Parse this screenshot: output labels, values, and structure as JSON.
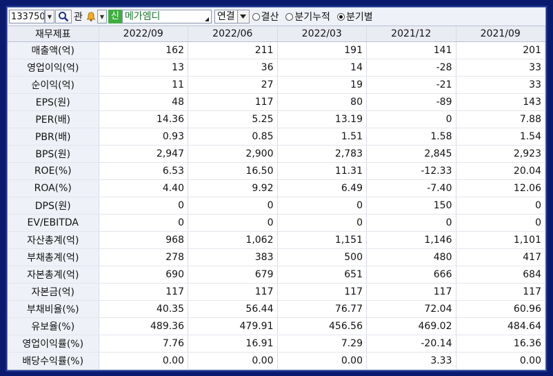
{
  "toolbar": {
    "stock_code": "133750",
    "label_gwan": "관",
    "new_badge": "신",
    "company_name": "메가엠디",
    "report_select": "연결",
    "radios": [
      {
        "label": "결산",
        "checked": false
      },
      {
        "label": "분기누적",
        "checked": false
      },
      {
        "label": "분기별",
        "checked": true
      }
    ],
    "icons": [
      "search-icon",
      "bell-icon",
      "dropdown-arrow-icon"
    ]
  },
  "table": {
    "header_label": "재무제표",
    "periods": [
      "2022/09",
      "2022/06",
      "2022/03",
      "2021/12",
      "2021/09"
    ],
    "rows": [
      {
        "label": "매출액(억)",
        "values": [
          "162",
          "211",
          "191",
          "141",
          "201"
        ]
      },
      {
        "label": "영업이익(억)",
        "values": [
          "13",
          "36",
          "14",
          "-28",
          "33"
        ]
      },
      {
        "label": "순이익(억)",
        "values": [
          "11",
          "27",
          "19",
          "-21",
          "33"
        ]
      },
      {
        "label": "EPS(원)",
        "values": [
          "48",
          "117",
          "80",
          "-89",
          "143"
        ]
      },
      {
        "label": "PER(배)",
        "values": [
          "14.36",
          "5.25",
          "13.19",
          "0",
          "7.88"
        ]
      },
      {
        "label": "PBR(배)",
        "values": [
          "0.93",
          "0.85",
          "1.51",
          "1.58",
          "1.54"
        ]
      },
      {
        "label": "BPS(원)",
        "values": [
          "2,947",
          "2,900",
          "2,783",
          "2,845",
          "2,923"
        ]
      },
      {
        "label": "ROE(%)",
        "values": [
          "6.53",
          "16.50",
          "11.31",
          "-12.33",
          "20.04"
        ]
      },
      {
        "label": "ROA(%)",
        "values": [
          "4.40",
          "9.92",
          "6.49",
          "-7.40",
          "12.06"
        ]
      },
      {
        "label": "DPS(원)",
        "values": [
          "0",
          "0",
          "0",
          "150",
          "0"
        ]
      },
      {
        "label": "EV/EBITDA",
        "values": [
          "0",
          "0",
          "0",
          "0",
          "0"
        ]
      },
      {
        "label": "자산총계(억)",
        "values": [
          "968",
          "1,062",
          "1,151",
          "1,146",
          "1,101"
        ]
      },
      {
        "label": "부채총계(억)",
        "values": [
          "278",
          "383",
          "500",
          "480",
          "417"
        ]
      },
      {
        "label": "자본총계(억)",
        "values": [
          "690",
          "679",
          "651",
          "666",
          "684"
        ]
      },
      {
        "label": "자본금(억)",
        "values": [
          "117",
          "117",
          "117",
          "117",
          "117"
        ]
      },
      {
        "label": "부채비율(%)",
        "values": [
          "40.35",
          "56.44",
          "76.77",
          "72.04",
          "60.96"
        ]
      },
      {
        "label": "유보율(%)",
        "values": [
          "489.36",
          "479.91",
          "456.56",
          "469.02",
          "484.64"
        ]
      },
      {
        "label": "영업이익률(%)",
        "values": [
          "7.76",
          "16.91",
          "7.29",
          "-20.14",
          "16.36"
        ]
      },
      {
        "label": "배당수익률(%)",
        "values": [
          "0.00",
          "0.00",
          "0.00",
          "3.33",
          "0.00"
        ]
      }
    ]
  },
  "colors": {
    "background": "#0a1a6e",
    "badge": "#3fae3f",
    "company_name": "#1a7a2e"
  }
}
